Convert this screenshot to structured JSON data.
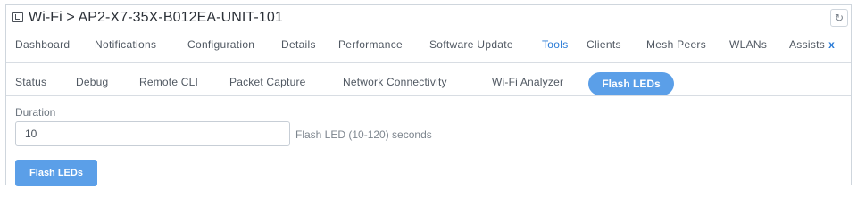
{
  "window": {
    "title": "Wi-Fi > AP2-X7-35X-B012EA-UNIT-101",
    "app_icon": "window-icon",
    "refresh_icon": "refresh-icon"
  },
  "primary_tabs": [
    {
      "label": "Dashboard"
    },
    {
      "label": "Notifications"
    },
    {
      "label": "Configuration"
    },
    {
      "label": "Details"
    },
    {
      "label": "Performance"
    },
    {
      "label": "Software Update"
    },
    {
      "label": "Tools"
    },
    {
      "label": "Clients"
    },
    {
      "label": "Mesh Peers"
    },
    {
      "label": "WLANs"
    },
    {
      "label": "Assists",
      "close": "x"
    }
  ],
  "primary_active": "Tools",
  "secondary_tabs": [
    {
      "label": "Status"
    },
    {
      "label": "Debug"
    },
    {
      "label": "Remote CLI"
    },
    {
      "label": "Packet Capture"
    },
    {
      "label": "Network Connectivity"
    },
    {
      "label": "Wi-Fi Analyzer"
    },
    {
      "label": "Flash LEDs"
    }
  ],
  "secondary_active": "Flash LEDs",
  "form": {
    "duration_label": "Duration",
    "duration_value": "10",
    "duration_hint": "Flash LED (10-120) seconds",
    "submit_label": "Flash LEDs"
  },
  "colors": {
    "accent": "#5b9fe8",
    "active_tab_text": "#2a7bd6"
  }
}
